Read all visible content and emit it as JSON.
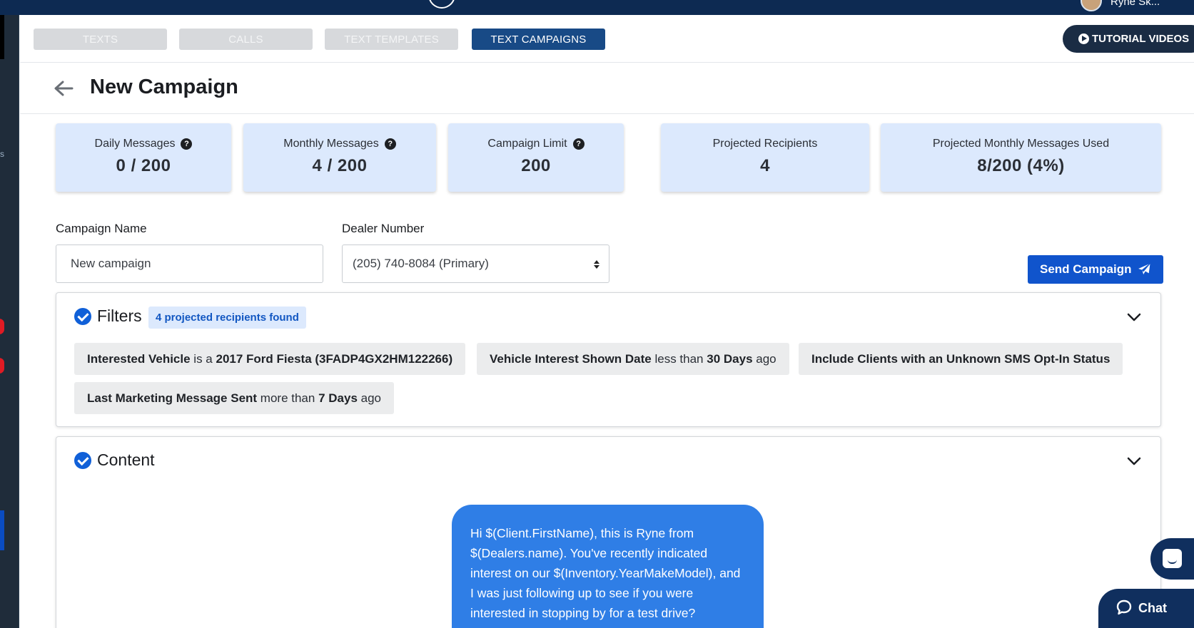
{
  "topbar": {
    "user_name": "Ryne Sk..."
  },
  "tabs": [
    {
      "label": "TEXTS",
      "active": false
    },
    {
      "label": "CALLS",
      "active": false
    },
    {
      "label": "TEXT TEMPLATES",
      "active": false
    },
    {
      "label": "TEXT CAMPAIGNS",
      "active": true
    }
  ],
  "tutorial_button": {
    "label": "TUTORIAL VIDEOS",
    "icon": "play-icon"
  },
  "header": {
    "title": "New Campaign",
    "back_icon": "arrow-left-icon"
  },
  "stats": [
    {
      "label": "Daily Messages",
      "value": "0 / 200",
      "help": true
    },
    {
      "label": "Monthly Messages",
      "value": "4 / 200",
      "help": true
    },
    {
      "label": "Campaign Limit",
      "value": "200",
      "help": true
    },
    {
      "label": "Projected Recipients",
      "value": "4",
      "help": false
    },
    {
      "label": "Projected Monthly Messages Used",
      "value": "8/200 (4%)",
      "help": false
    }
  ],
  "help_glyph": "?",
  "form": {
    "campaign_name_label": "Campaign Name",
    "campaign_name_value": "New campaign",
    "dealer_number_label": "Dealer Number",
    "dealer_number_value": "(205) 740-8084 (Primary)",
    "send_button": "Send Campaign"
  },
  "filters": {
    "title": "Filters",
    "badge": "4 projected recipients found",
    "chips": [
      {
        "b1": "Interested Vehicle",
        "t1": " is a ",
        "b2": "2017 Ford Fiesta (3FADP4GX2HM122266)",
        "t2": ""
      },
      {
        "b1": "Vehicle Interest Shown Date",
        "t1": " less than ",
        "b2": "30 Days",
        "t2": " ago"
      },
      {
        "b1": "Include Clients with an Unknown SMS Opt-In Status",
        "t1": "",
        "b2": "",
        "t2": ""
      },
      {
        "b1": "Last Marketing Message Sent",
        "t1": " more than ",
        "b2": "7 Days",
        "t2": " ago"
      }
    ]
  },
  "content": {
    "title": "Content",
    "message": "Hi $(Client.FirstName), this is Ryne from $(Dealers.name). You've recently indicated interest on our $(Inventory.YearMakeModel), and I was just following up to see if you were interested in stopping by for a test drive?"
  },
  "chat": {
    "label": "Chat"
  },
  "colors": {
    "accent": "#1054cc",
    "nav": "#0d2a52",
    "card": "#dce9fd",
    "bubble": "#2f7ee6"
  }
}
